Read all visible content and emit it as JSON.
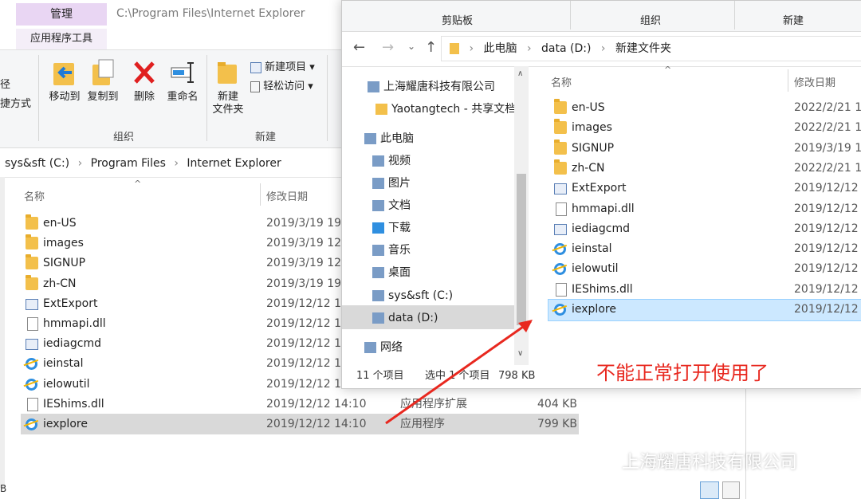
{
  "back_window": {
    "tab_manage": "管理",
    "title_path": "C:\\Program Files\\Internet Explorer",
    "app_tools": "应用程序工具",
    "ribbon": {
      "left_cut_1": "径",
      "left_cut_2": "捷方式",
      "move_to": "移动到",
      "copy_to": "复制到",
      "delete": "删除",
      "rename": "重命名",
      "new_folder_1": "新建",
      "new_folder_2": "文件夹",
      "new_item": "新建项目",
      "easy_access": "轻松访问",
      "group_organize": "组织",
      "group_new": "新建"
    },
    "breadcrumb": [
      "sys&sft (C:)",
      "Program Files",
      "Internet Explorer"
    ],
    "columns": {
      "name": "名称",
      "date": "修改日期"
    },
    "files": [
      {
        "name": "en-US",
        "date": "2019/3/19 19:",
        "type": "",
        "size": "",
        "icon": "folder-icon"
      },
      {
        "name": "images",
        "date": "2019/3/19 12:",
        "type": "",
        "size": "",
        "icon": "folder-icon"
      },
      {
        "name": "SIGNUP",
        "date": "2019/3/19 12:",
        "type": "",
        "size": "",
        "icon": "folder-icon"
      },
      {
        "name": "zh-CN",
        "date": "2019/3/19 19:",
        "type": "",
        "size": "",
        "icon": "folder-icon"
      },
      {
        "name": "ExtExport",
        "date": "2019/12/12 14:",
        "type": "",
        "size": "",
        "icon": "exe-icon"
      },
      {
        "name": "hmmapi.dll",
        "date": "2019/12/12 14:",
        "type": "",
        "size": "",
        "icon": "dll-file-icon"
      },
      {
        "name": "iediagcmd",
        "date": "2019/12/12 14:",
        "type": "",
        "size": "",
        "icon": "exe-icon"
      },
      {
        "name": "ieinstal",
        "date": "2019/12/12 14:",
        "type": "",
        "size": "",
        "icon": "ie-icon"
      },
      {
        "name": "ielowutil",
        "date": "2019/12/12 14:",
        "type": "",
        "size": "",
        "icon": "ie-icon"
      },
      {
        "name": "IEShims.dll",
        "date": "2019/12/12 14:10",
        "type": "应用程序扩展",
        "size": "404 KB",
        "icon": "dll-file-icon"
      },
      {
        "name": "iexplore",
        "date": "2019/12/12 14:10",
        "type": "应用程序",
        "size": "799 KB",
        "icon": "ie-icon"
      }
    ],
    "status_cut": "B"
  },
  "front_window": {
    "groups": {
      "clipboard": "剪贴板",
      "organize": "组织",
      "new": "新建"
    },
    "breadcrumb": [
      "此电脑",
      "data (D:)",
      "新建文件夹"
    ],
    "nav_tree": [
      {
        "label": "上海耀唐科技有限公司",
        "icon": "building-icon"
      },
      {
        "label": "Yaotangtech - 共享文档",
        "icon": "folder-icon"
      },
      {
        "label": "此电脑",
        "icon": "computer-icon"
      },
      {
        "label": "视频",
        "icon": "video-icon"
      },
      {
        "label": "图片",
        "icon": "pictures-icon"
      },
      {
        "label": "文档",
        "icon": "documents-icon"
      },
      {
        "label": "下载",
        "icon": "download-icon"
      },
      {
        "label": "音乐",
        "icon": "music-icon"
      },
      {
        "label": "桌面",
        "icon": "desktop-icon"
      },
      {
        "label": "sys&sft (C:)",
        "icon": "drive-icon"
      },
      {
        "label": "data (D:)",
        "icon": "drive-icon"
      },
      {
        "label": "网络",
        "icon": "network-icon"
      }
    ],
    "columns": {
      "name": "名称",
      "date": "修改日期"
    },
    "files": [
      {
        "name": "en-US",
        "date": "2022/2/21 1",
        "icon": "folder-icon"
      },
      {
        "name": "images",
        "date": "2022/2/21 1",
        "icon": "folder-icon"
      },
      {
        "name": "SIGNUP",
        "date": "2019/3/19 1",
        "icon": "folder-icon"
      },
      {
        "name": "zh-CN",
        "date": "2022/2/21 1",
        "icon": "folder-icon"
      },
      {
        "name": "ExtExport",
        "date": "2019/12/12",
        "icon": "exe-icon"
      },
      {
        "name": "hmmapi.dll",
        "date": "2019/12/12",
        "icon": "dll-file-icon"
      },
      {
        "name": "iediagcmd",
        "date": "2019/12/12",
        "icon": "exe-icon"
      },
      {
        "name": "ieinstal",
        "date": "2019/12/12",
        "icon": "ie-icon"
      },
      {
        "name": "ielowutil",
        "date": "2019/12/12",
        "icon": "ie-icon"
      },
      {
        "name": "IEShims.dll",
        "date": "2019/12/12",
        "icon": "dll-file-icon"
      },
      {
        "name": "iexplore",
        "date": "2019/12/12",
        "icon": "ie-icon"
      }
    ],
    "status": {
      "count": "11 个项目",
      "selected": "选中 1 个项目",
      "size": "798 KB"
    }
  },
  "annotation": "不能正常打开使用了",
  "watermark": "上海耀唐科技有限公司",
  "colors": {
    "annotation_red": "#e8281f",
    "selection_blue": "#cce8ff",
    "manage_purple": "#e9d6f3"
  }
}
